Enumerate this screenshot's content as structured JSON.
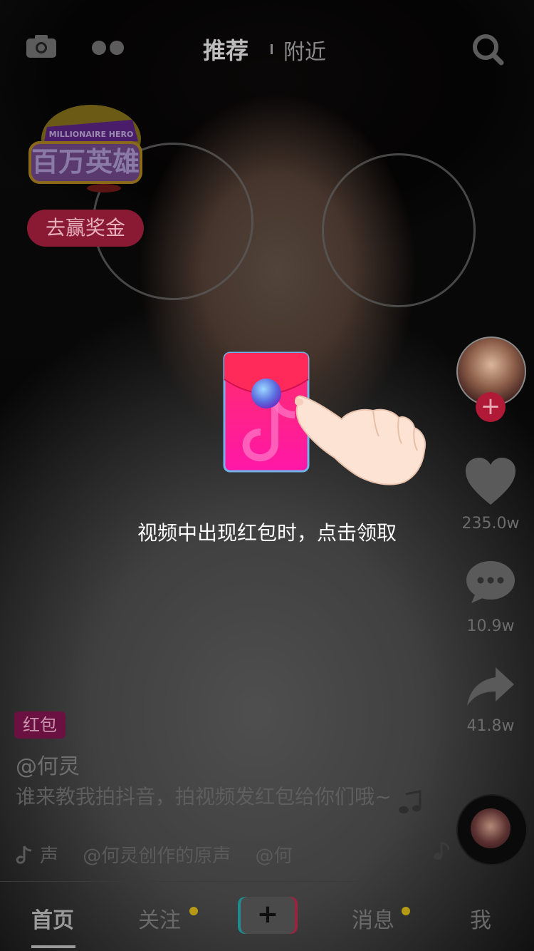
{
  "header": {
    "tab_recommend": "推荐",
    "tab_nearby": "附近"
  },
  "promo": {
    "badge_text_cn": "百万英雄",
    "badge_text_en": "MILLIONAIRE HERO",
    "button_label": "去赢奖金"
  },
  "rail": {
    "like_count": "235.0w",
    "comment_count": "10.9w",
    "share_count": "41.8w"
  },
  "post": {
    "tag": "红包",
    "author": "@何灵",
    "caption": "谁来教我拍抖音，拍视频发红包给你们哦~",
    "music": "声　 @何灵创作的原声　 @何"
  },
  "tabs": {
    "home": "首页",
    "follow": "关注",
    "add": "+",
    "messages": "消息",
    "me": "我"
  },
  "guide": {
    "text": "视频中出现红包时，点击领取"
  },
  "colors": {
    "packet_pink": "#ff1f8e",
    "accent_red": "#b01a37",
    "notify_dot": "#b59a16"
  }
}
